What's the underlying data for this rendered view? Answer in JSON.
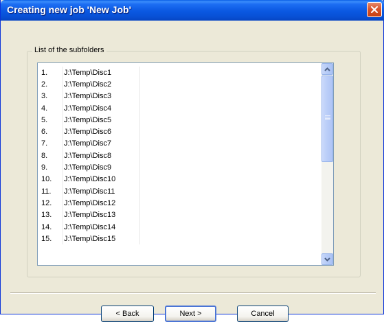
{
  "window": {
    "title": "Creating new job 'New Job'"
  },
  "group": {
    "legend": "List of the subfolders"
  },
  "list": {
    "rows": [
      {
        "num": "1.",
        "path": "J:\\Temp\\Disc1"
      },
      {
        "num": "2.",
        "path": "J:\\Temp\\Disc2"
      },
      {
        "num": "3.",
        "path": "J:\\Temp\\Disc3"
      },
      {
        "num": "4.",
        "path": "J:\\Temp\\Disc4"
      },
      {
        "num": "5.",
        "path": "J:\\Temp\\Disc5"
      },
      {
        "num": "6.",
        "path": "J:\\Temp\\Disc6"
      },
      {
        "num": "7.",
        "path": "J:\\Temp\\Disc7"
      },
      {
        "num": "8.",
        "path": "J:\\Temp\\Disc8"
      },
      {
        "num": "9.",
        "path": "J:\\Temp\\Disc9"
      },
      {
        "num": "10.",
        "path": "J:\\Temp\\Disc10"
      },
      {
        "num": "11.",
        "path": "J:\\Temp\\Disc11"
      },
      {
        "num": "12.",
        "path": "J:\\Temp\\Disc12"
      },
      {
        "num": "13.",
        "path": "J:\\Temp\\Disc13"
      },
      {
        "num": "14.",
        "path": "J:\\Temp\\Disc14"
      },
      {
        "num": "15.",
        "path": "J:\\Temp\\Disc15"
      }
    ]
  },
  "buttons": {
    "back_label": "< Back",
    "next_label": "Next >",
    "cancel_label": "Cancel"
  },
  "icons": {
    "close": "close-icon",
    "scroll_up": "chevron-up-icon",
    "scroll_down": "chevron-down-icon"
  },
  "colors": {
    "titlebar": "#0a58e1",
    "close_button": "#d8542b",
    "dialog_face": "#ece9d8",
    "scrollbar_accent": "#b6cbf7"
  }
}
